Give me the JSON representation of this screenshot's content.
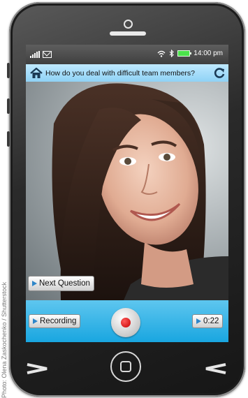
{
  "credit": "Photo: Olena Zaskochenko / Shutterstock",
  "status_bar": {
    "time": "14:00 pm"
  },
  "question_bar": {
    "question": "How do you deal with difficult team members?"
  },
  "buttons": {
    "next_question": "Next Question",
    "recording": "Recording",
    "timer": "0:22"
  },
  "colors": {
    "accent": "#19a6e0",
    "question_bar": "#a7ddf8",
    "record": "#d11212",
    "battery": "#4be34b"
  },
  "icons": [
    "signal-icon",
    "mail-icon",
    "wifi-icon",
    "bluetooth-icon",
    "battery-icon",
    "home-icon",
    "refresh-icon",
    "play-icon",
    "record-icon",
    "back-icon",
    "menu-icon"
  ]
}
